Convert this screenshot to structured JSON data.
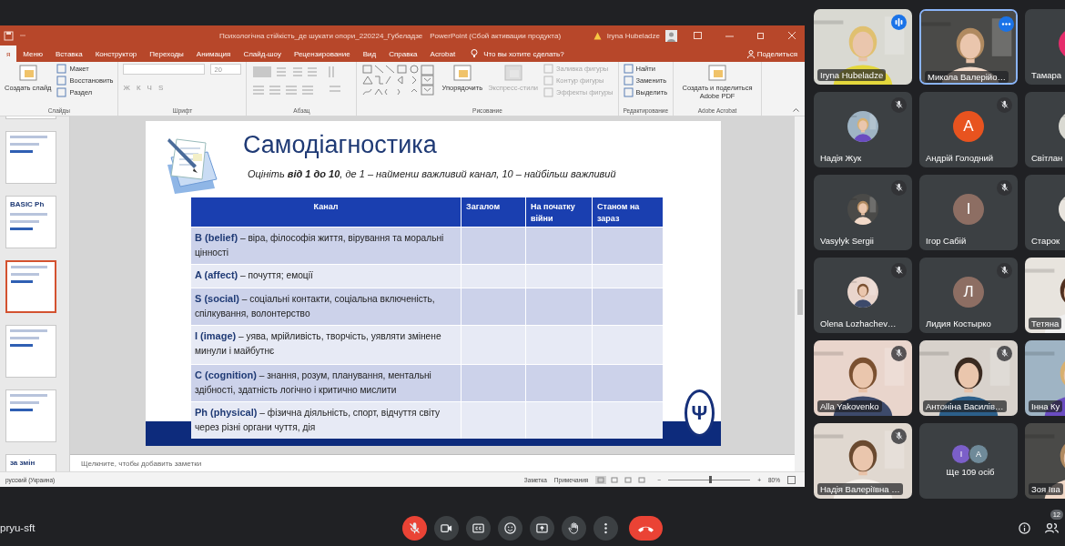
{
  "powerpoint": {
    "document_title": "Психологічна стійкість_де шукати опори_220224_Губеладзе",
    "app_title": "PowerPoint (Сбой активации продукта)",
    "user": "Iryna Hubeladze",
    "tabs": [
      {
        "label": "я",
        "selected": true
      },
      {
        "label": "Меню",
        "selected": false
      },
      {
        "label": "Вставка",
        "selected": false
      },
      {
        "label": "Конструктор",
        "selected": false
      },
      {
        "label": "Переходы",
        "selected": false
      },
      {
        "label": "Анимация",
        "selected": false
      },
      {
        "label": "Слайд-шоу",
        "selected": false
      },
      {
        "label": "Рецензирование",
        "selected": false
      },
      {
        "label": "Вид",
        "selected": false
      },
      {
        "label": "Справка",
        "selected": false
      },
      {
        "label": "Acrobat",
        "selected": false
      }
    ],
    "tell_me": "Что вы хотите сделать?",
    "share": "Поделиться",
    "ribbon_groups": [
      {
        "label": "Слайды",
        "columns": [
          [
            {
              "kind": "large",
              "label": "Создать слайд",
              "disabled": false
            }
          ],
          [
            {
              "kind": "small",
              "label": "Макет",
              "disabled": false
            },
            {
              "kind": "small",
              "label": "Восстановить",
              "disabled": false
            },
            {
              "kind": "small",
              "label": "Раздел",
              "disabled": false
            }
          ]
        ]
      },
      {
        "label": "Шрифт",
        "columns": [
          [
            {
              "kind": "font-name"
            },
            {
              "kind": "format-keys",
              "keys": [
                "Ж",
                "К",
                "Ч",
                "S"
              ]
            }
          ],
          [
            {
              "kind": "font-size",
              "value": "20"
            }
          ]
        ]
      },
      {
        "label": "Абзац",
        "columns": [
          [
            {
              "kind": "paragraph-tools"
            }
          ]
        ]
      },
      {
        "label": "Рисование",
        "columns": [
          [
            {
              "kind": "shapes"
            }
          ],
          [
            {
              "kind": "large",
              "label": "Упорядочить",
              "disabled": false
            }
          ],
          [
            {
              "kind": "large",
              "label": "Экспресс-стили",
              "disabled": true
            }
          ],
          [
            {
              "kind": "small",
              "label": "Заливка фигуры",
              "disabled": true
            },
            {
              "kind": "small",
              "label": "Контур фигуры",
              "disabled": true
            },
            {
              "kind": "small",
              "label": "Эффекты фигуры",
              "disabled": true
            }
          ]
        ]
      },
      {
        "label": "Редактирование",
        "columns": [
          [
            {
              "kind": "small",
              "label": "Найти",
              "disabled": false
            },
            {
              "kind": "small",
              "label": "Заменить",
              "disabled": false
            },
            {
              "kind": "small",
              "label": "Выделить",
              "disabled": false
            }
          ]
        ]
      },
      {
        "label": "Adobe Acrobat",
        "columns": [
          [
            {
              "kind": "large",
              "label": "Создать и поделиться Adobe PDF",
              "disabled": false
            }
          ]
        ]
      }
    ],
    "thumbnails": [
      {
        "selected": false
      },
      {
        "selected": false
      },
      {
        "selected": false,
        "heading": "BASIC Ph"
      },
      {
        "selected": true
      },
      {
        "selected": false
      },
      {
        "selected": false
      },
      {
        "selected": false,
        "heading": "за змін"
      }
    ],
    "slide": {
      "title": "Самодіагностика",
      "subtitle": "Оцініть **від 1 до 10**, де 1 – найменш важливий канал, 10 – найбільш важливий",
      "logo": "Ψ",
      "columns": [
        "Канал",
        "Загалом",
        "На початку війни",
        "Станом на зараз"
      ],
      "rows": [
        {
          "channel": "**B (belief)** – віра, філософія життя, вірування та моральні цінності"
        },
        {
          "channel": "**A (affect)** – почуття; емоції"
        },
        {
          "channel": "**S (social)** – соціальні контакти, соціальна включеність, спілкування, волонтерство"
        },
        {
          "channel": "**I (image)** – уява, мрійливість, творчість, уявляти змінене минули і майбутнє"
        },
        {
          "channel": "**C (cognition)** – знання, розум, планування, ментальні здібності, здатність логічно і критично мислити"
        },
        {
          "channel": "**Ph (physical)** – фізична діяльність, спорт, відчуття світу через різні органи чуття, дія"
        }
      ]
    },
    "notes_placeholder": "Щелкните, чтобы добавить заметки",
    "status": {
      "language": "русский (Украина)",
      "notes": "Заметка",
      "comments": "Примечания",
      "zoom": "80%",
      "zoom_out": "−",
      "zoom_in": "+",
      "level": 0.5
    }
  },
  "meet": {
    "tiles": [
      {
        "kind": "video",
        "name": "Iryna Hubeladze",
        "muted": false,
        "speaking": true,
        "focused": false
      },
      {
        "kind": "video",
        "name": "Микола Валерійо…",
        "muted": false,
        "speaking": false,
        "focused": true
      },
      {
        "kind": "avatar-letter",
        "name": "Тамара",
        "color": "#e52c6b",
        "focused": false
      },
      {
        "kind": "avatar-photo",
        "name": "Надія Жук",
        "muted": true,
        "speaking": false,
        "focused": false
      },
      {
        "kind": "avatar-letter",
        "name": "Андрій Голодний",
        "letter": "А",
        "color": "#e8531f",
        "muted": true,
        "speaking": false,
        "focused": false
      },
      {
        "kind": "avatar-photo",
        "name": "Світлан",
        "focused": false
      },
      {
        "kind": "avatar-photo",
        "name": "Vasylyk Sergii",
        "muted": true,
        "speaking": false,
        "focused": false
      },
      {
        "kind": "avatar-letter",
        "name": "Ігор Сабій",
        "letter": "І",
        "color": "#8d6e63",
        "muted": true,
        "speaking": false,
        "focused": false
      },
      {
        "kind": "avatar-photo",
        "name": "Старок",
        "focused": false
      },
      {
        "kind": "avatar-photo",
        "name": "Olena Lozhachev…",
        "muted": true,
        "speaking": false,
        "focused": false
      },
      {
        "kind": "avatar-letter",
        "name": "Лидия Костырко",
        "letter": "Л",
        "color": "#8d6e63",
        "muted": true,
        "speaking": false,
        "focused": false
      },
      {
        "kind": "video",
        "name": "Тетяна",
        "focused": false
      },
      {
        "kind": "video",
        "name": "Alla Yakovenko",
        "muted": true,
        "speaking": false,
        "focused": false
      },
      {
        "kind": "video",
        "name": "Антоніна Василів…",
        "muted": true,
        "speaking": false,
        "focused": false
      },
      {
        "kind": "video",
        "name": "Інна Ку",
        "focused": false
      },
      {
        "kind": "video",
        "name": "Надія Валеріївна …",
        "muted": true,
        "speaking": false,
        "focused": false
      },
      {
        "kind": "more",
        "name": "Ще 109 осіб",
        "avatars": [
          {
            "letter": "І",
            "color": "#7b5fc9"
          },
          {
            "letter": "А",
            "color": "#6f8a99"
          }
        ],
        "muted": false,
        "speaking": false,
        "focused": false
      },
      {
        "kind": "video",
        "name": "Зоя Іва",
        "focused": false
      }
    ],
    "meeting_code": "pryu-sft",
    "mic_muted": true,
    "participants_count": "12"
  }
}
